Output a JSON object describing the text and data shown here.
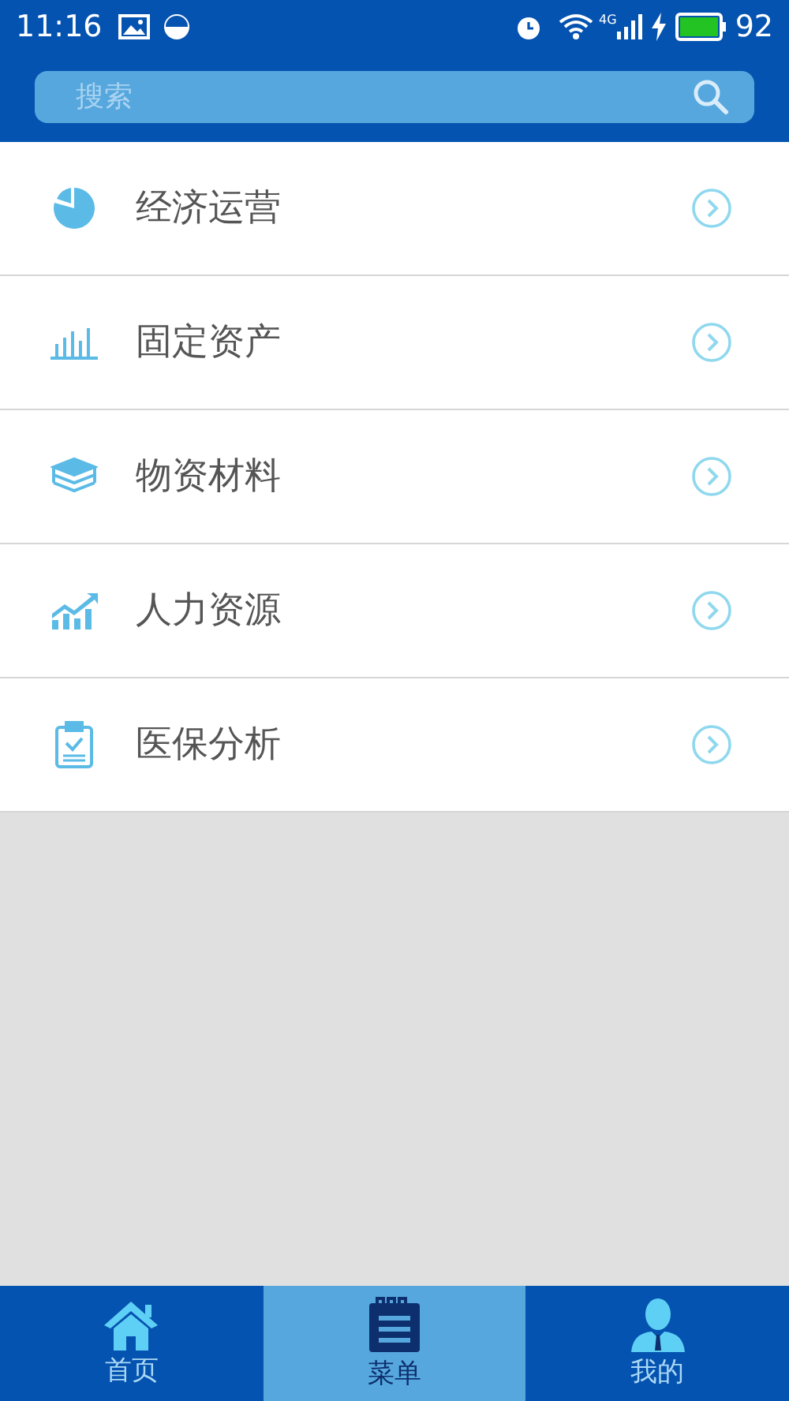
{
  "status_bar": {
    "time": "11:16",
    "network": "4G",
    "battery": "92"
  },
  "search": {
    "placeholder": "搜索"
  },
  "menu": [
    {
      "label": "经济运营",
      "kind": "pie"
    },
    {
      "label": "固定资产",
      "kind": "bars"
    },
    {
      "label": "物资材料",
      "kind": "stack"
    },
    {
      "label": "人力资源",
      "kind": "trend"
    },
    {
      "label": "医保分析",
      "kind": "clipboard"
    }
  ],
  "tabs": [
    {
      "label": "首页",
      "kind": "home",
      "selected": false
    },
    {
      "label": "菜单",
      "kind": "notepad",
      "selected": true
    },
    {
      "label": "我的",
      "kind": "person",
      "selected": false
    }
  ]
}
